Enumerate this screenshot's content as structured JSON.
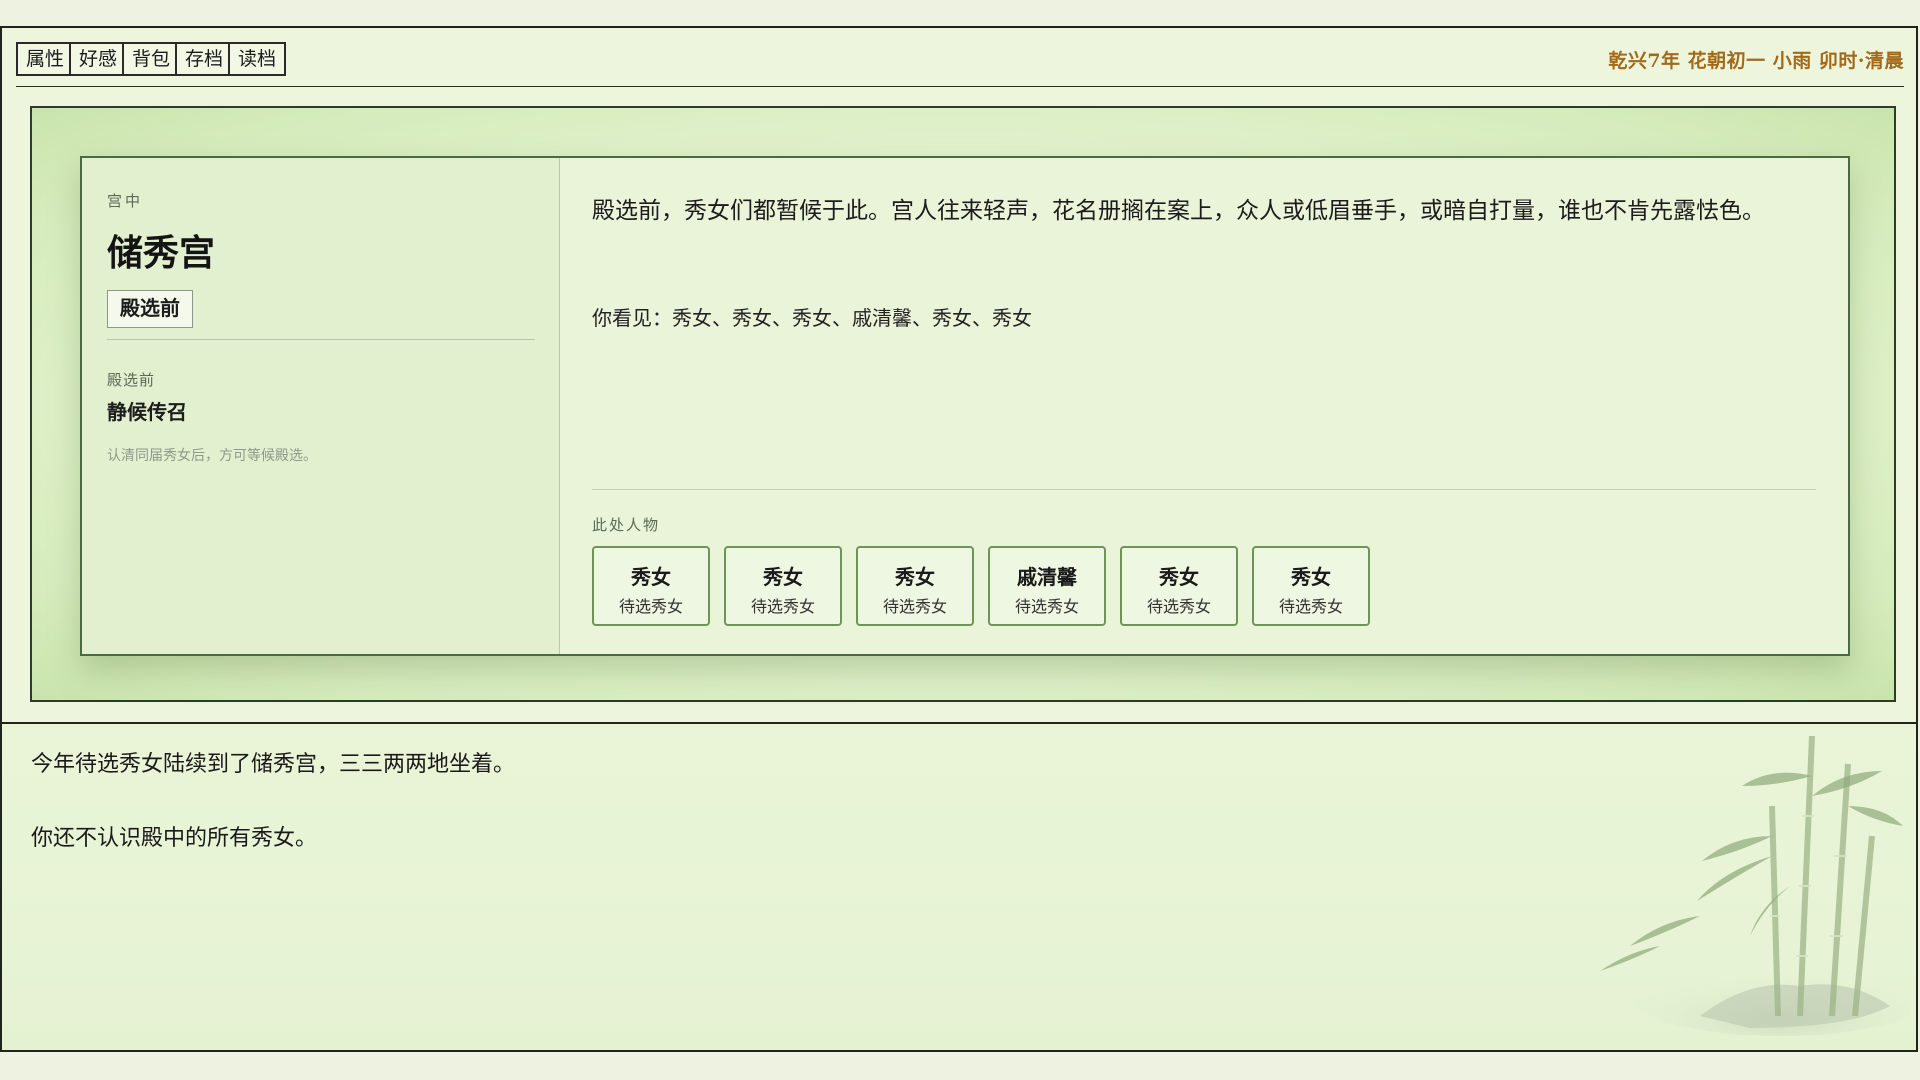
{
  "toolbar": {
    "buttons": [
      "属性",
      "好感",
      "背包",
      "存档",
      "读档"
    ],
    "datetime": "乾兴7年 花朝初一 小雨 卯时·清晨"
  },
  "location": {
    "region": "宫中",
    "name": "储秀宫",
    "tag": "殿选前"
  },
  "stage": {
    "label": "殿选前",
    "name": "静候传召",
    "hint": "认清同届秀女后，方可等候殿选。"
  },
  "scene": {
    "description": "殿选前，秀女们都暂候于此。宫人往来轻声，花名册搁在案上，众人或低眉垂手，或暗自打量，谁也不肯先露怯色。",
    "seen": "你看见：秀女、秀女、秀女、戚清馨、秀女、秀女",
    "people_label": "此处人物"
  },
  "people": [
    {
      "name": "秀女",
      "role": "待选秀女"
    },
    {
      "name": "秀女",
      "role": "待选秀女"
    },
    {
      "name": "秀女",
      "role": "待选秀女"
    },
    {
      "name": "戚清馨",
      "role": "待选秀女"
    },
    {
      "name": "秀女",
      "role": "待选秀女"
    },
    {
      "name": "秀女",
      "role": "待选秀女"
    }
  ],
  "log": [
    "今年待选秀女陆续到了储秀宫，三三两两地坐着。",
    "你还不认识殿中的所有秀女。"
  ],
  "colors": {
    "accent_gold": "#a06a1a",
    "card_border": "#4c6a3f",
    "person_border": "#6f9457"
  },
  "decor": {
    "corner_art": "bamboo-painting-icon"
  }
}
